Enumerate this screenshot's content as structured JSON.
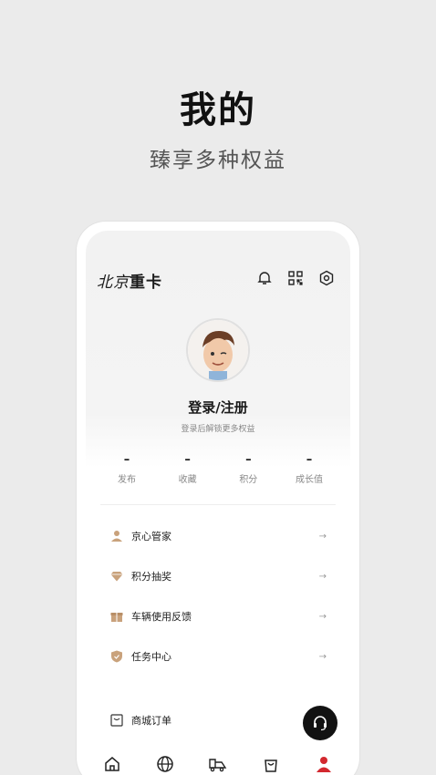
{
  "promo": {
    "title": "我的",
    "subtitle": "臻享多种权益"
  },
  "header": {
    "logo_script": "北京",
    "logo_text": "重卡"
  },
  "profile": {
    "login_title": "登录/注册",
    "login_subtitle": "登录后解锁更多权益"
  },
  "stats": [
    {
      "value": "–",
      "label": "发布"
    },
    {
      "value": "–",
      "label": "收藏"
    },
    {
      "value": "–",
      "label": "积分"
    },
    {
      "value": "–",
      "label": "成长值"
    }
  ],
  "menu": [
    {
      "label": "京心管家",
      "icon": "butler-icon"
    },
    {
      "label": "积分抽奖",
      "icon": "diamond-icon"
    },
    {
      "label": "车辆使用反馈",
      "icon": "gift-box-icon"
    },
    {
      "label": "任务中心",
      "icon": "shield-icon"
    }
  ],
  "menu2": [
    {
      "label": "商城订单",
      "icon": "order-icon"
    }
  ],
  "arrow": "→",
  "tabs": [
    "home-tab",
    "discover-tab",
    "truck-tab",
    "shop-tab",
    "profile-tab"
  ],
  "colors": {
    "accent": "#d3282f",
    "icon_tan": "#c9a27c",
    "dark": "#121212"
  }
}
